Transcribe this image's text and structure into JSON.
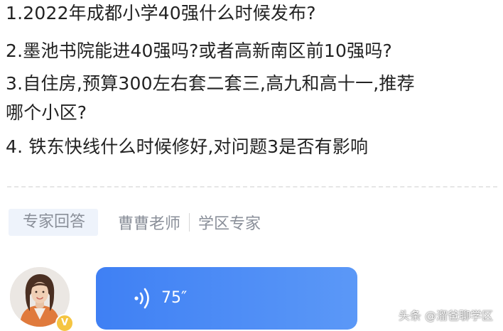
{
  "questions": [
    "1.2022年成都小学40强什么时候发布?",
    "2.墨池书院能进40强吗?或者高新南区前10强吗?",
    "3.自住房,预算300左右套二套三,高九和高十一,推荐",
    "哪个小区?",
    "4. 铁东快线什么时候修好,对问题3是否有影响"
  ],
  "expert": {
    "tag": "专家回答",
    "name": "曹曹老师",
    "title": "学区专家"
  },
  "avatar": {
    "badge_label": "V",
    "badge_color": "#f5c542"
  },
  "voice": {
    "duration": "75″",
    "bubble_color": "#4a8cf6",
    "icon": "sound-wave-icon"
  },
  "watermark": "头条 @溜爸聊学区"
}
